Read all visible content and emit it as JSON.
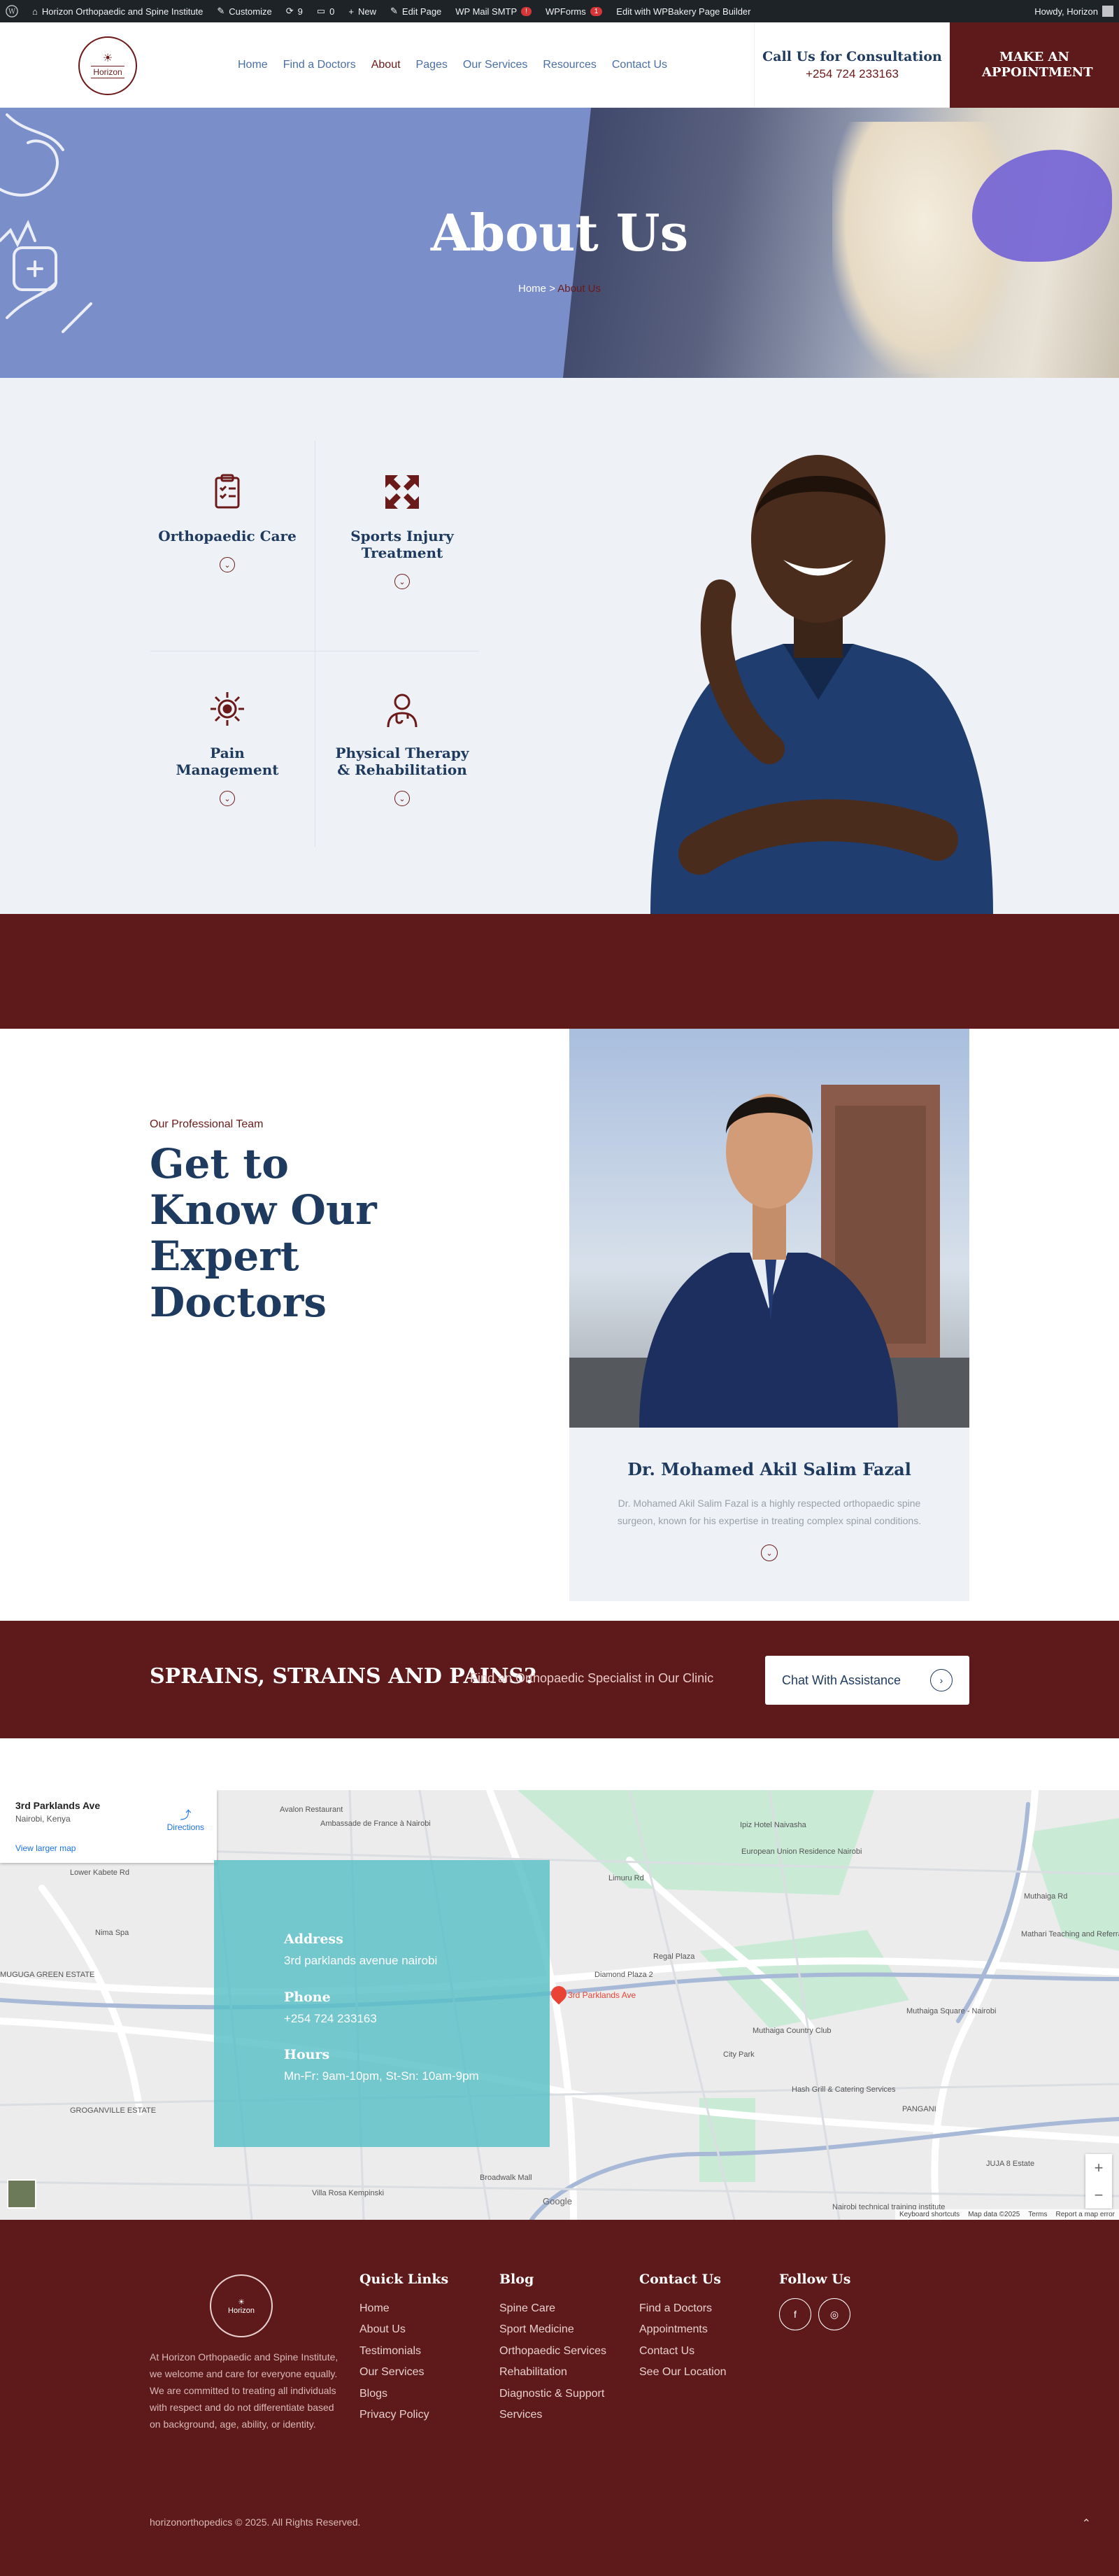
{
  "admin_bar": {
    "site_name": "Horizon Orthopaedic and Spine Institute",
    "customize": "Customize",
    "updates_count": "9",
    "comments_count": "0",
    "new": "New",
    "edit_page": "Edit Page",
    "wp_mail_smtp": "WP Mail SMTP",
    "wp_mail_smtp_badge": "!",
    "wpforms": "WPForms",
    "wpforms_badge": "1",
    "wpbakery": "Edit with WPBakery Page Builder",
    "howdy": "Howdy, Horizon"
  },
  "header": {
    "logo_text": "Horizon",
    "nav": [
      "Home",
      "Find a Doctors",
      "About",
      "Pages",
      "Our Services",
      "Resources",
      "Contact Us"
    ],
    "active_nav": "About",
    "consult_title": "Call Us for Consultation",
    "consult_phone": "+254 724 233163",
    "appointment_button": "MAKE AN APPOINTMENT"
  },
  "hero": {
    "title": "About Us",
    "breadcrumb_home": "Home",
    "breadcrumb_separator": ">",
    "breadcrumb_current": "About Us"
  },
  "services": [
    {
      "label": "Orthopaedic Care",
      "icon": "clipboard-checklist-icon"
    },
    {
      "label": "Sports Injury Treatment",
      "icon": "arrows-expand-icon"
    },
    {
      "label": "Pain Management",
      "icon": "pain-burst-icon"
    },
    {
      "label": "Physical Therapy & Rehabilitation",
      "icon": "doctor-icon"
    }
  ],
  "team": {
    "kicker": "Our Professional Team",
    "heading": "Get to Know Our Expert Doctors",
    "doctor_name": "Dr. Mohamed Akil Salim Fazal",
    "doctor_bio": "Dr. Mohamed Akil Salim Fazal is a highly respected orthopaedic spine surgeon, known for his expertise in treating complex spinal conditions."
  },
  "cta": {
    "headline": "SPRAINS, STRAINS AND PAINS?",
    "subtext": "Find an Orthopaedic Specialist in Our Clinic",
    "button": "Chat With Assistance"
  },
  "map": {
    "place_title": "3rd Parklands Ave",
    "place_sub": "Nairobi, Kenya",
    "directions": "Directions",
    "larger_map": "View larger map",
    "pin_label": "3rd Parklands Ave",
    "labels": [
      "Avalon Restaurant",
      "Ambassade de France à Nairobi",
      "Lower Kabete Rd",
      "Nima Spa",
      "Diamond Plaza 2",
      "Regal Plaza",
      "Muthaiga Country Club",
      "Muthaiga Square - Nairobi",
      "Mathari Teaching and Referral Hospital",
      "City Park",
      "Hash Grill & Catering Services",
      "PANGANI",
      "JUJA 8 Estate",
      "Broadwalk Mall",
      "Villa Rosa Kempinski",
      "MUGUGA GREEN ESTATE",
      "GROGANVILLE ESTATE",
      "Ipiz Hotel Naivasha",
      "European Union Residence Nairobi",
      "Muthaiga Rd",
      "Limuru Rd",
      "Nairobi technical training institute"
    ],
    "footer": [
      "Keyboard shortcuts",
      "Map data ©2025",
      "Terms",
      "Report a map error"
    ],
    "google": "Google",
    "zoom_in": "+",
    "zoom_out": "−"
  },
  "contact_overlay": {
    "address_label": "Address",
    "address": "3rd parklands avenue nairobi",
    "phone_label": "Phone",
    "phone": "+254 724 233163",
    "hours_label": "Hours",
    "hours": "Mn-Fr: 9am-10pm, St-Sn: 10am-9pm"
  },
  "footer": {
    "logo_text": "Horizon",
    "about": "At Horizon Orthopaedic and Spine Institute, we welcome and care for everyone equally. We are committed to treating all individuals with respect and do not differentiate based on background, age, ability, or identity.",
    "quick_links_title": "Quick Links",
    "quick_links": [
      "Home",
      "About Us",
      "Testimonials",
      "Our Services",
      "Blogs",
      "Privacy Policy"
    ],
    "blog_title": "Blog",
    "blog_links": [
      "Spine Care",
      "Sport Medicine",
      "Orthopaedic Services",
      "Rehabilitation",
      "Diagnostic & Support Services"
    ],
    "contact_title": "Contact Us",
    "contact_links": [
      "Find a Doctors",
      "Appointments",
      "Contact Us",
      "See Our Location"
    ],
    "follow_title": "Follow Us",
    "social": [
      "facebook-icon",
      "instagram-icon"
    ],
    "copyright": "horizonorthopedics © 2025. All Rights Reserved."
  },
  "colors": {
    "maroon": "#5e1a1a",
    "navy": "#1e3a5f",
    "hero_blue": "#7a8fc9",
    "teal_overlay": "#57bfc6"
  }
}
